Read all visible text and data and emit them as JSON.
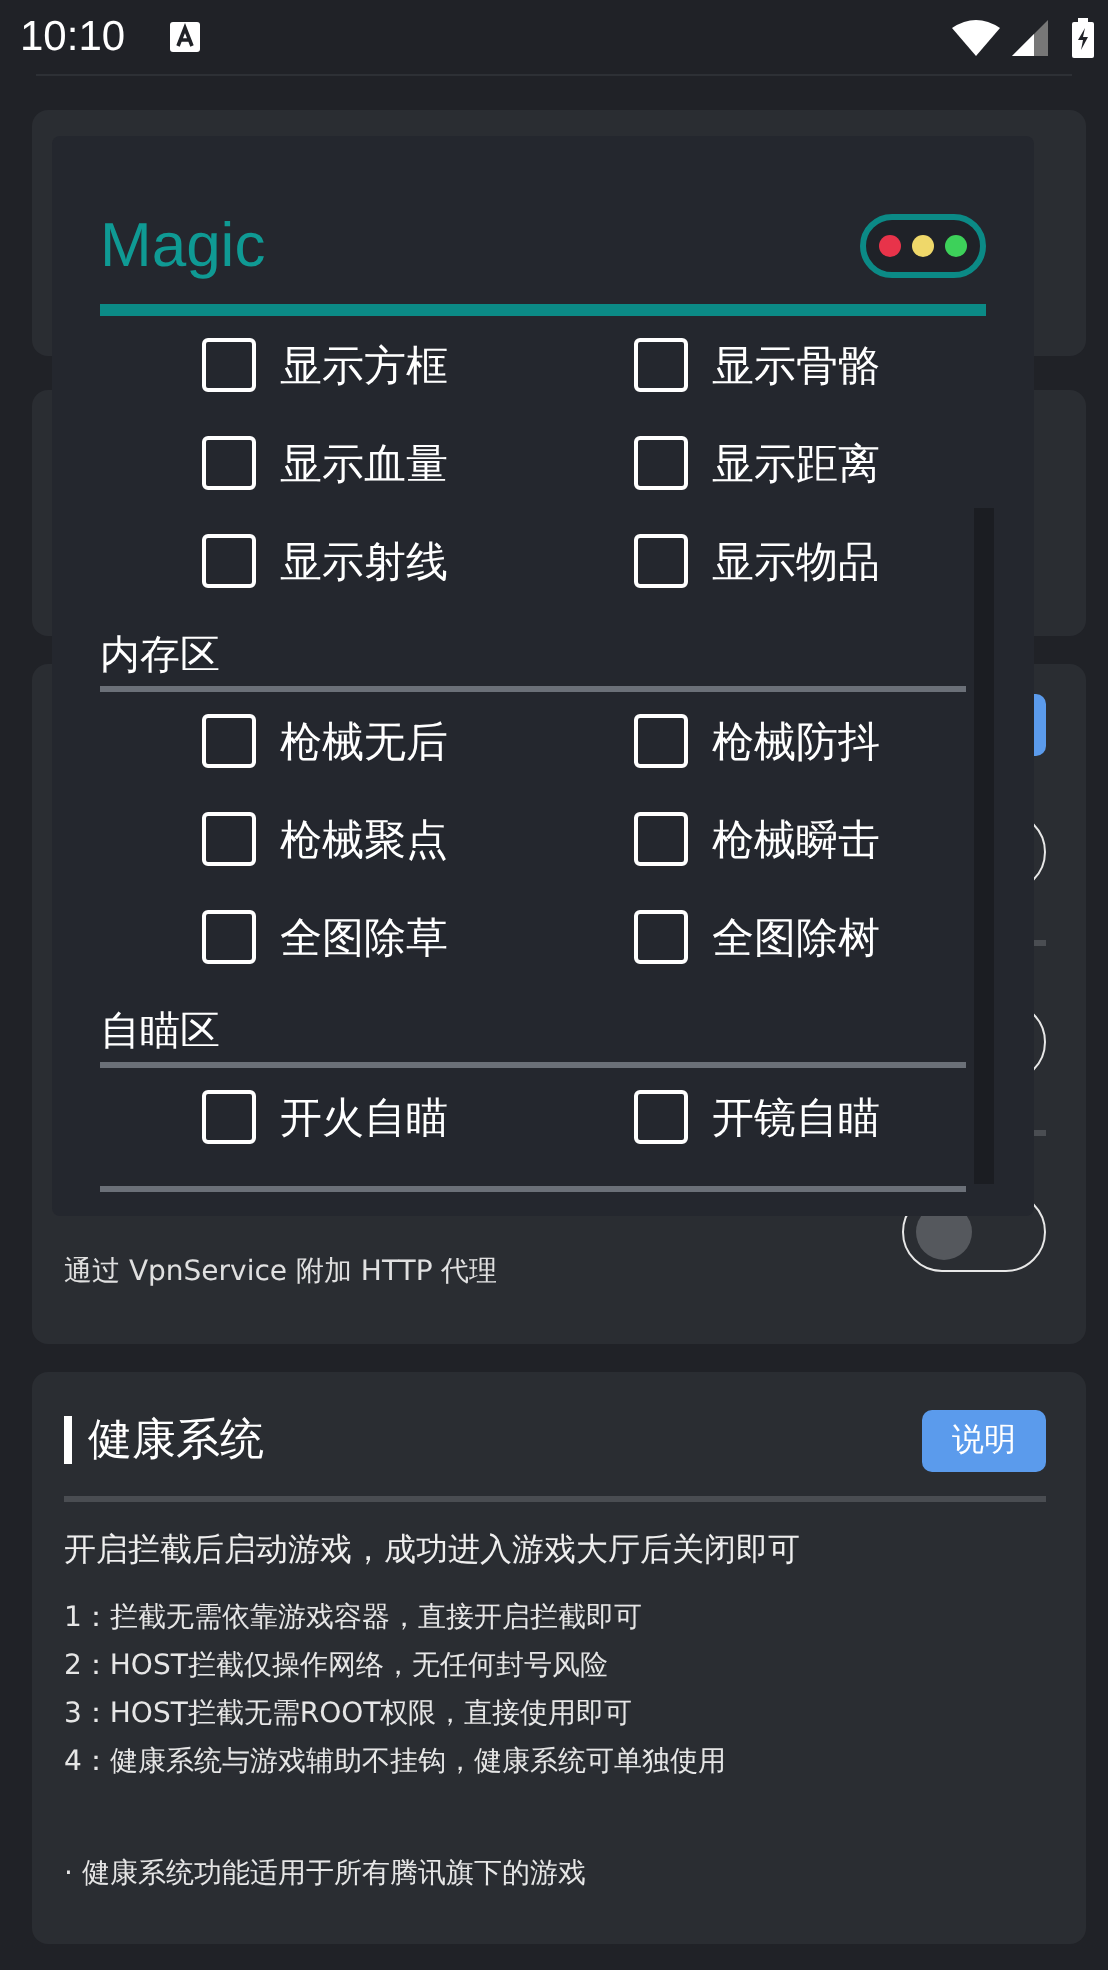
{
  "status_bar": {
    "time": "10:10"
  },
  "settings": {
    "rows": [
      {
        "on": false
      },
      {
        "on": false
      },
      {
        "subtitle": "通过 VpnService 附加 HTTP 代理",
        "on": false
      }
    ]
  },
  "health": {
    "title": "健康系统",
    "button": "说明",
    "intro": "开启拦截后启动游戏，成功进入游戏大厅后关闭即可",
    "items": [
      "1：拦截无需依靠游戏容器，直接开启拦截即可",
      "2：HOST拦截仅操作网络，无任何封号风险",
      "3：HOST拦截无需ROOT权限，直接使用即可",
      "4：健康系统与游戏辅助不挂钩，健康系统可单独使用"
    ],
    "note": "· 健康系统功能适用于所有腾讯旗下的游戏"
  },
  "overlay": {
    "title": "Magic",
    "sections": [
      {
        "options": [
          {
            "label": "显示方框",
            "checked": false
          },
          {
            "label": "显示骨骼",
            "checked": false
          },
          {
            "label": "显示血量",
            "checked": false
          },
          {
            "label": "显示距离",
            "checked": false
          },
          {
            "label": "显示射线",
            "checked": false
          },
          {
            "label": "显示物品",
            "checked": false
          }
        ]
      },
      {
        "label": "内存区",
        "options": [
          {
            "label": "枪械无后",
            "checked": false
          },
          {
            "label": "枪械防抖",
            "checked": false
          },
          {
            "label": "枪械聚点",
            "checked": false
          },
          {
            "label": "枪械瞬击",
            "checked": false
          },
          {
            "label": "全图除草",
            "checked": false
          },
          {
            "label": "全图除树",
            "checked": false
          }
        ]
      },
      {
        "label": "自瞄区",
        "options": [
          {
            "label": "开火自瞄",
            "checked": false
          },
          {
            "label": "开镜自瞄",
            "checked": false
          }
        ]
      }
    ]
  }
}
